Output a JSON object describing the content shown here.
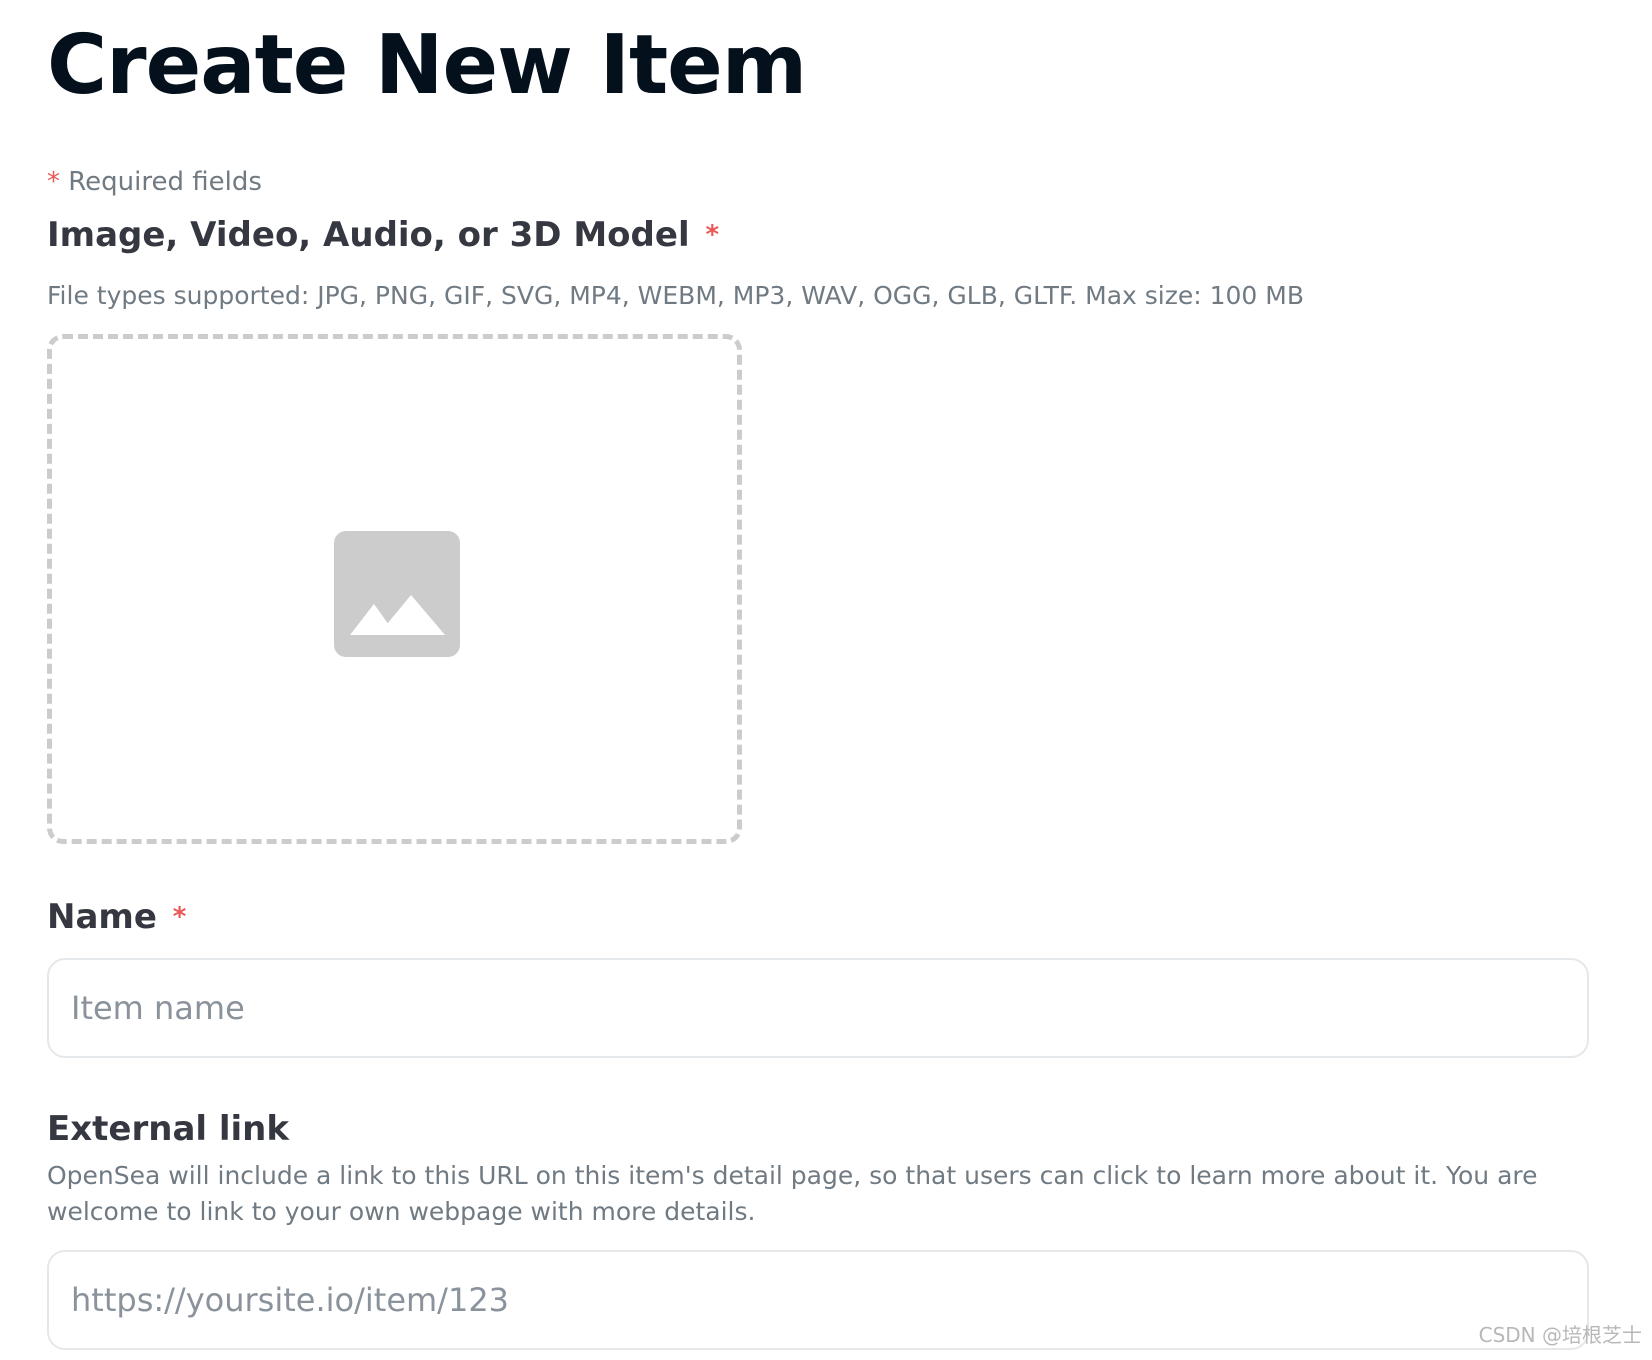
{
  "page": {
    "title": "Create New Item"
  },
  "required_note": {
    "star": "*",
    "text": "Required fields"
  },
  "media": {
    "label": "Image, Video, Audio, or 3D Model",
    "required_star": "*",
    "hint": "File types supported: JPG, PNG, GIF, SVG, MP4, WEBM, MP3, WAV, OGG, GLB, GLTF. Max size: 100 MB",
    "icon": "image-placeholder-icon"
  },
  "name_field": {
    "label": "Name",
    "required_star": "*",
    "placeholder": "Item name",
    "value": ""
  },
  "external_link": {
    "label": "External link",
    "hint": "OpenSea will include a link to this URL on this item's detail page, so that users can click to learn more about it. You are welcome to link to your own webpage with more details.",
    "placeholder": "https://yoursite.io/item/123",
    "value": ""
  },
  "watermark": {
    "text": "CSDN @培根芝士"
  },
  "colors": {
    "title": "#04111d",
    "label": "#353840",
    "hint": "#707a83",
    "required": "#eb5757",
    "dashed_border": "#cccccc",
    "input_border": "#e5e8eb",
    "icon_fill": "#cccccc"
  }
}
